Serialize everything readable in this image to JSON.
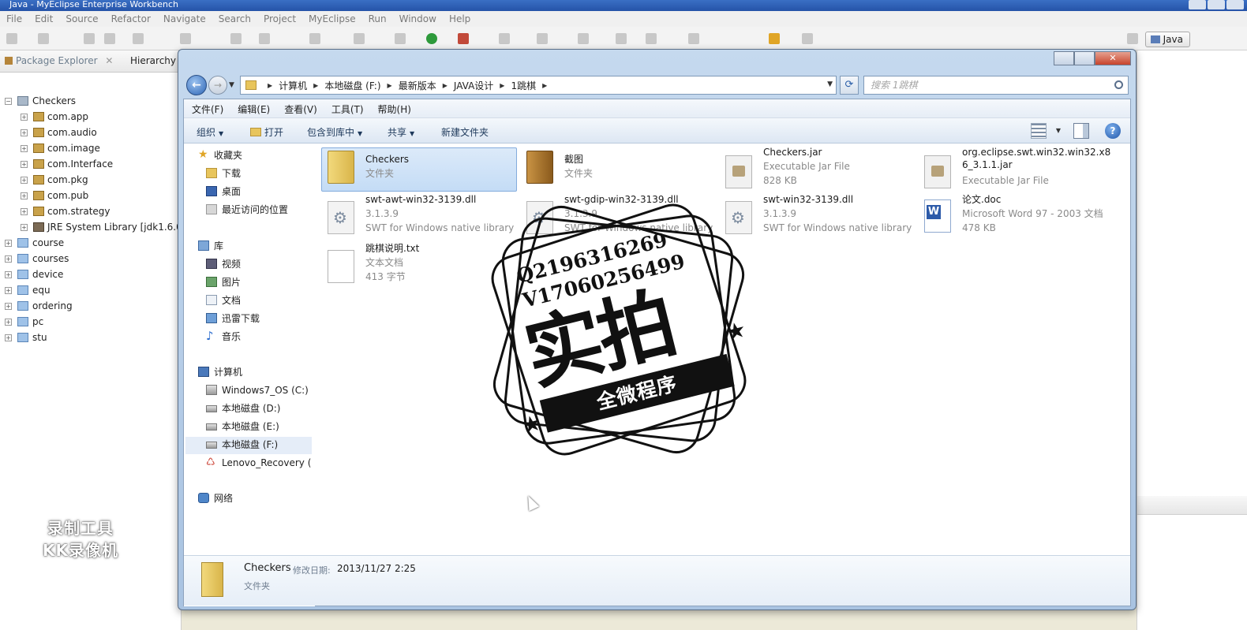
{
  "eclipse": {
    "title": "Java - MyEclipse Enterprise Workbench",
    "menu": [
      "File",
      "Edit",
      "Source",
      "Refactor",
      "Navigate",
      "Search",
      "Project",
      "MyEclipse",
      "Run",
      "Window",
      "Help"
    ],
    "perspective": "Java",
    "panel_tabs": {
      "package_explorer": "Package Explorer",
      "close": "✕",
      "hierarchy": "Hierarchy"
    },
    "tree": {
      "root": "Checkers",
      "packages": [
        "com.app",
        "com.audio",
        "com.image",
        "com.Interface",
        "com.pkg",
        "com.pub",
        "com.strategy"
      ],
      "library": "JRE System Library [jdk1.6.0",
      "projects": [
        "course",
        "courses",
        "device",
        "equ",
        "ordering",
        "pc",
        "stu"
      ]
    }
  },
  "recorder_watermark": {
    "line1": "录制工具",
    "line2": "KK录像机"
  },
  "explorer": {
    "window_controls": {
      "minimize": "",
      "maximize": "",
      "close": "✕"
    },
    "breadcrumbs": [
      "计算机",
      "本地磁盘 (F:)",
      "最新版本",
      "JAVA设计",
      "1跳棋"
    ],
    "search_placeholder": "搜索 1跳棋",
    "menu": [
      "文件(F)",
      "编辑(E)",
      "查看(V)",
      "工具(T)",
      "帮助(H)"
    ],
    "commands": {
      "organize": "组织",
      "open": "打开",
      "include_in_library": "包含到库中",
      "share": "共享",
      "new_folder": "新建文件夹"
    },
    "nav": {
      "favorites": "收藏夹",
      "fav_items": [
        "下载",
        "桌面",
        "最近访问的位置"
      ],
      "libraries": "库",
      "lib_items": [
        "视频",
        "图片",
        "文档",
        "迅雷下载",
        "音乐"
      ],
      "computer": "计算机",
      "drives": [
        "Windows7_OS (C:)",
        "本地磁盘 (D:)",
        "本地磁盘 (E:)",
        "本地磁盘 (F:)",
        "Lenovo_Recovery ("
      ],
      "network": "网络"
    },
    "files": [
      {
        "name": "Checkers",
        "line2": "文件夹",
        "line3": ""
      },
      {
        "name": "截图",
        "line2": "文件夹",
        "line3": ""
      },
      {
        "name": "Checkers.jar",
        "line2": "Executable Jar File",
        "line3": "828 KB"
      },
      {
        "name": "org.eclipse.swt.win32.win32.x86_3.1.1.jar",
        "line2": "Executable Jar File",
        "line3": ""
      },
      {
        "name": "swt-awt-win32-3139.dll",
        "line2": "3.1.3.9",
        "line3": "SWT for Windows native library"
      },
      {
        "name": "swt-gdip-win32-3139.dll",
        "line2": "3.1.3.9",
        "line3": "SWT for Windows native library"
      },
      {
        "name": "swt-win32-3139.dll",
        "line2": "3.1.3.9",
        "line3": "SWT for Windows native library"
      },
      {
        "name": "论文.doc",
        "line2": "Microsoft Word 97 - 2003 文档",
        "line3": "478 KB"
      },
      {
        "name": "跳棋说明.txt",
        "line2": "文本文档",
        "line3": "413 字节"
      }
    ],
    "details": {
      "name": "Checkers",
      "date_label": "修改日期:",
      "date": "2013/11/27 2:25",
      "type": "文件夹"
    }
  },
  "stamp": {
    "qq": "Q2196316269",
    "wechat": "V17060256499",
    "big": "实拍",
    "banner": "全微程序"
  }
}
